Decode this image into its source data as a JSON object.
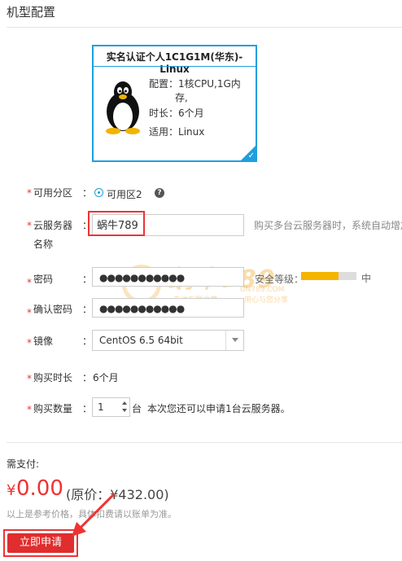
{
  "section": {
    "title": "机型配置"
  },
  "instance_card": {
    "title": "实名认证个人1C1G1M(华东)-Linux",
    "spec_config_label": "配置：",
    "spec_config_value_line1": "1核CPU,1G内",
    "spec_config_value_line2": "存,",
    "spec_duration_label": "时长：",
    "spec_duration_value": "6个月",
    "spec_os_label": "适用：",
    "spec_os_value": "Linux",
    "selected": true
  },
  "form": {
    "zone": {
      "required": "*",
      "label": "可用分区",
      "colon": "：",
      "option": "可用区2",
      "help": "?"
    },
    "server": {
      "required": "*",
      "label_line1": "云服务器",
      "label_line2": "名称",
      "colon": "：",
      "value": "蜗牛789",
      "hint": "购买多台云服务器时，系统自动增加"
    },
    "password": {
      "required": "*",
      "label": "密码",
      "colon": "：",
      "value": "●●●●●●●●●●●",
      "strength_label": "安全等级：",
      "strength_text": "中",
      "strength_level": 0.67
    },
    "confirm_password": {
      "required": "*",
      "label": "确认密码",
      "colon": "：",
      "value": "●●●●●●●●●●●"
    },
    "image": {
      "required": "*",
      "label": "镜像",
      "colon": "：",
      "value": "CentOS 6.5 64bit"
    },
    "duration": {
      "required": "*",
      "label": "购买时长",
      "colon": "：",
      "value": "6个月"
    },
    "quantity": {
      "required": "*",
      "label": "购买数量",
      "colon": "：",
      "value": "1",
      "unit": "台",
      "note": "本次您还可以申请1台云服务器。"
    }
  },
  "payment": {
    "label": "需支付:",
    "currency": "¥",
    "amount": "0.00",
    "original": "(原价：¥432.00)",
    "note": "以上是参考价格，具体扣费请以账单为准。",
    "submit_label": "立即申请"
  },
  "watermark": {
    "brand": "蜗牛789",
    "domain": "UN789.COM",
    "slogan_left": "专注互联收藏",
    "slogan_right": "用心与您分享"
  },
  "colors": {
    "accent_blue": "#1e9fde",
    "danger_red": "#e33333",
    "strength_fill": "#f5b400"
  }
}
